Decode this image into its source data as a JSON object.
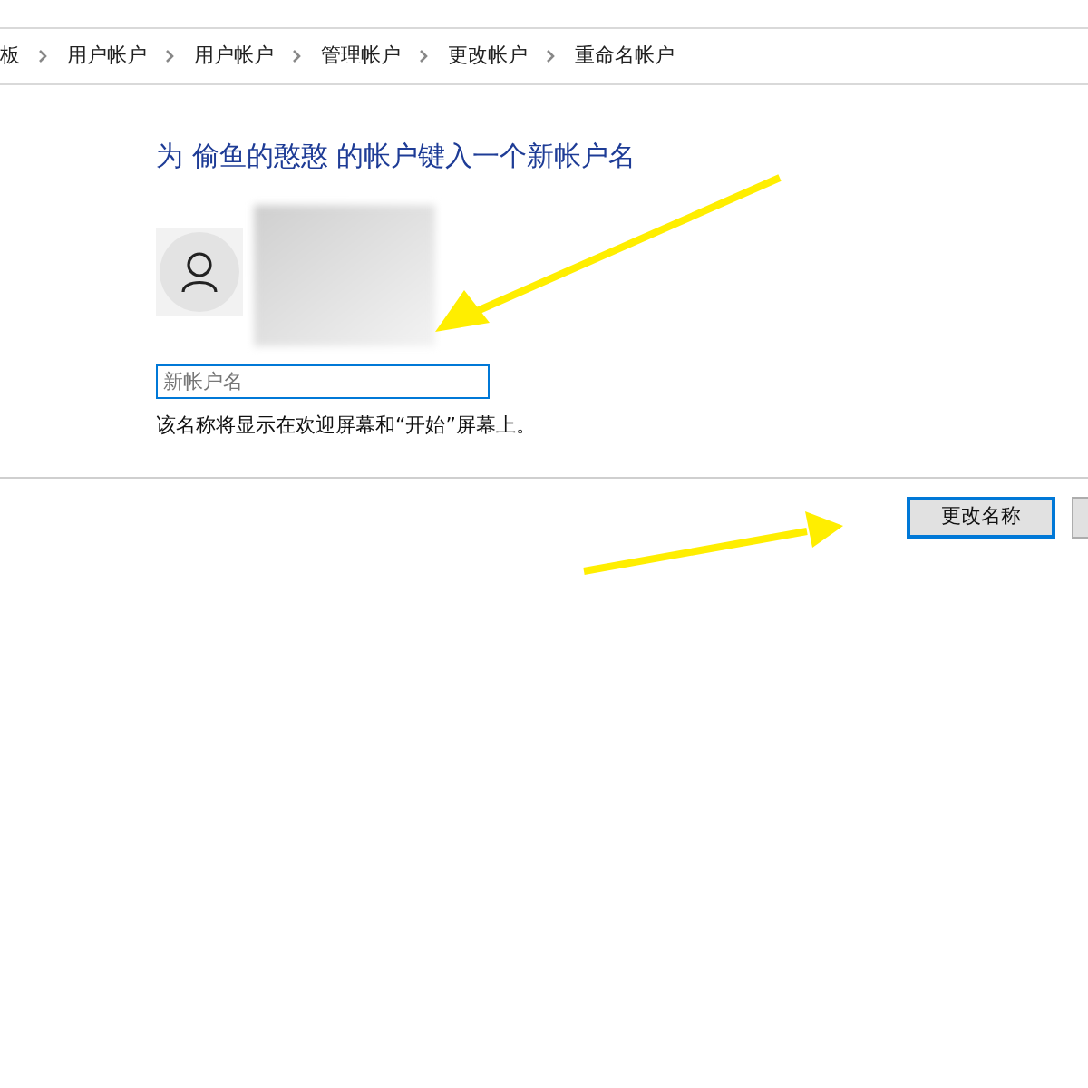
{
  "breadcrumb": [
    {
      "label": "板"
    },
    {
      "label": "用户帐户"
    },
    {
      "label": "用户帐户"
    },
    {
      "label": "管理帐户"
    },
    {
      "label": "更改帐户"
    },
    {
      "label": "重命名帐户"
    }
  ],
  "heading": "为 偷鱼的憨憨 的帐户键入一个新帐户名",
  "name_field": {
    "placeholder": "新帐户名"
  },
  "hint": "该名称将显示在欢迎屏幕和“开始”屏幕上。",
  "buttons": [
    {
      "label": "更改名称",
      "selected": true
    },
    {
      "selected": false
    }
  ]
}
